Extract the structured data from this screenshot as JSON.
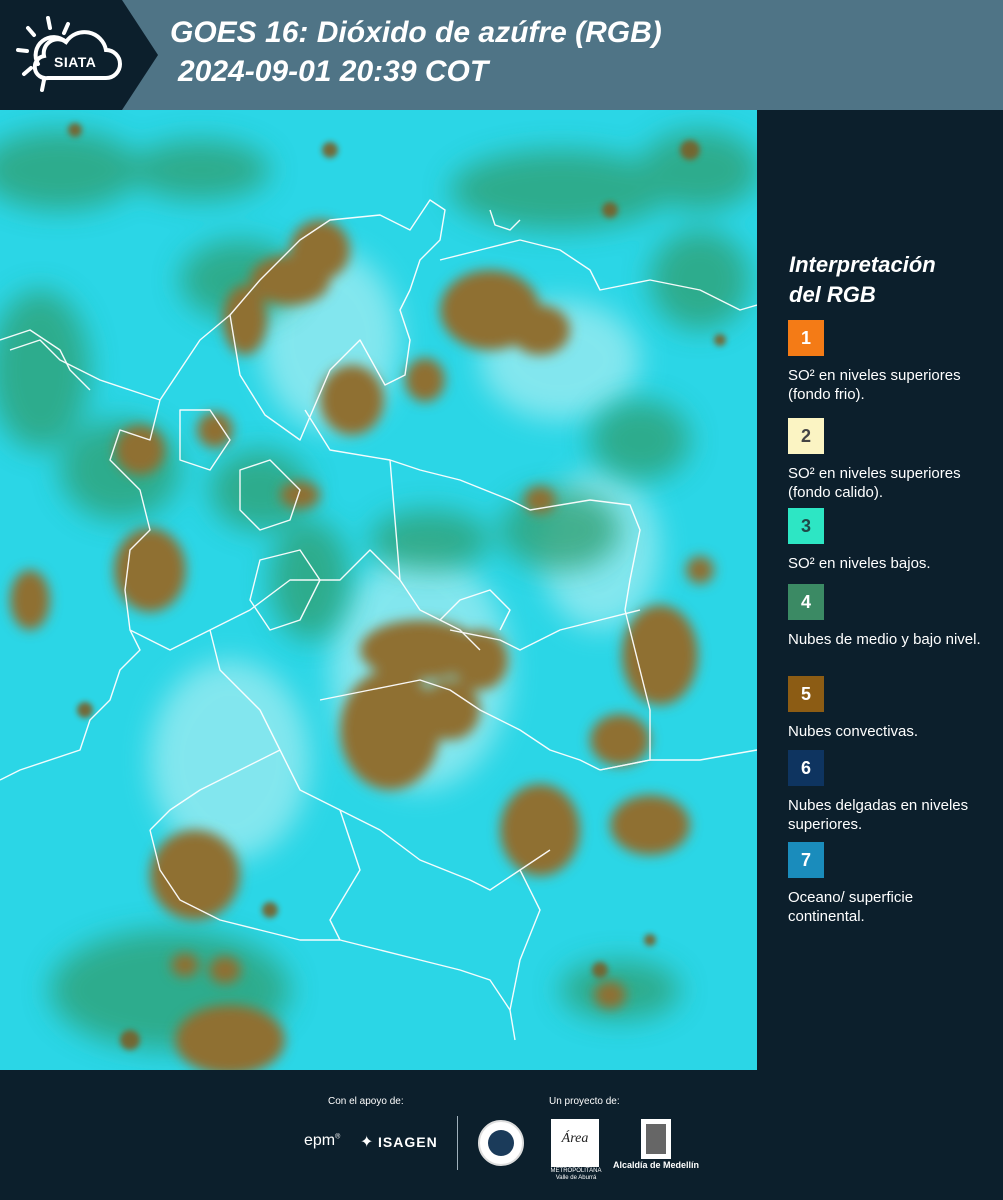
{
  "header": {
    "logo_text": "SIATA",
    "title": "GOES 16: Dióxido de azúfre (RGB)",
    "datetime": "2024-09-01 20:39 COT"
  },
  "colors": {
    "header_band": "#4f7486",
    "background": "#0c1f2c",
    "ocean_surface": "#25d2e4",
    "low_cloud": "#2ea37a",
    "convective": "#8a6b2a"
  },
  "legend": {
    "title_line1": "Interpretación",
    "title_line2": "del RGB",
    "items": [
      {
        "number": "1",
        "color": "#f47b16",
        "number_color": "#ffffff",
        "label": "SO² en niveles superiores (fondo frio)."
      },
      {
        "number": "2",
        "color": "#fbf4c3",
        "number_color": "#444444",
        "label": "SO² en niveles superiores (fondo calido)."
      },
      {
        "number": "3",
        "color": "#2de6c4",
        "number_color": "#1f4a48",
        "label": "SO² en niveles bajos."
      },
      {
        "number": "4",
        "color": "#3b8a64",
        "number_color": "#ffffff",
        "label": "Nubes de medio y bajo nivel."
      },
      {
        "number": "5",
        "color": "#8c5c14",
        "number_color": "#ffffff",
        "label": "Nubes convectivas."
      },
      {
        "number": "6",
        "color": "#0e3460",
        "number_color": "#ffffff",
        "label": "Nubes delgadas en niveles superiores."
      },
      {
        "number": "7",
        "color": "#1a8cbc",
        "number_color": "#ffffff",
        "label": "Oceano/ superficie continental."
      }
    ]
  },
  "footer": {
    "support_label": "Con el apoyo de:",
    "project_label": "Un proyecto de:",
    "sponsor_1": "epm",
    "sponsor_2": "ISAGEN",
    "amva_name": "Área",
    "amva_sub": "METROPOLITANA Valle de Aburrá",
    "alcaldia_name": "Alcaldía de Medellín"
  }
}
